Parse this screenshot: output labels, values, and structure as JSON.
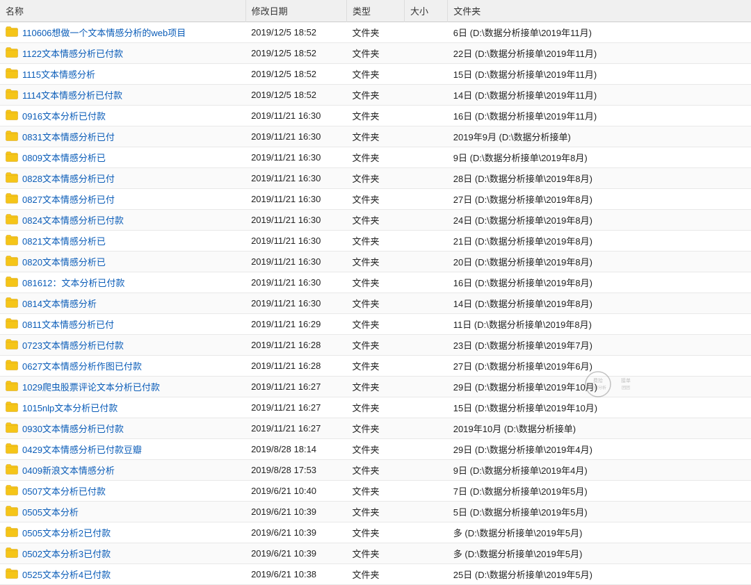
{
  "table": {
    "headers": [
      "名称",
      "修改日期",
      "类型",
      "大小",
      "文件夹"
    ],
    "rows": [
      {
        "name": "110606想做一个文本情感分析的web项目",
        "date": "2019/12/5 18:52",
        "type": "文件夹",
        "size": "",
        "folder": "6日 (D:\\数据分析接单\\2019年11月)"
      },
      {
        "name": "1122文本情感分析已付款",
        "date": "2019/12/5 18:52",
        "type": "文件夹",
        "size": "",
        "folder": "22日 (D:\\数据分析接单\\2019年11月)"
      },
      {
        "name": "1115文本情感分析",
        "date": "2019/12/5 18:52",
        "type": "文件夹",
        "size": "",
        "folder": "15日 (D:\\数据分析接单\\2019年11月)"
      },
      {
        "name": "1114文本情感分析已付款",
        "date": "2019/12/5 18:52",
        "type": "文件夹",
        "size": "",
        "folder": "14日 (D:\\数据分析接单\\2019年11月)"
      },
      {
        "name": "0916文本分析已付款",
        "date": "2019/11/21 16:30",
        "type": "文件夹",
        "size": "",
        "folder": "16日 (D:\\数据分析接单\\2019年11月)"
      },
      {
        "name": "0831文本情感分析已付",
        "date": "2019/11/21 16:30",
        "type": "文件夹",
        "size": "",
        "folder": "2019年9月 (D:\\数据分析接单)"
      },
      {
        "name": "0809文本情感分析已",
        "date": "2019/11/21 16:30",
        "type": "文件夹",
        "size": "",
        "folder": "9日 (D:\\数据分析接单\\2019年8月)"
      },
      {
        "name": "0828文本情感分析已付",
        "date": "2019/11/21 16:30",
        "type": "文件夹",
        "size": "",
        "folder": "28日 (D:\\数据分析接单\\2019年8月)"
      },
      {
        "name": "0827文本情感分析已付",
        "date": "2019/11/21 16:30",
        "type": "文件夹",
        "size": "",
        "folder": "27日 (D:\\数据分析接单\\2019年8月)"
      },
      {
        "name": "0824文本情感分析已付款",
        "date": "2019/11/21 16:30",
        "type": "文件夹",
        "size": "",
        "folder": "24日 (D:\\数据分析接单\\2019年8月)"
      },
      {
        "name": "0821文本情感分析已",
        "date": "2019/11/21 16:30",
        "type": "文件夹",
        "size": "",
        "folder": "21日 (D:\\数据分析接单\\2019年8月)"
      },
      {
        "name": "0820文本情感分析已",
        "date": "2019/11/21 16:30",
        "type": "文件夹",
        "size": "",
        "folder": "20日 (D:\\数据分析接单\\2019年8月)"
      },
      {
        "name": "081612：文本分析已付款",
        "date": "2019/11/21 16:30",
        "type": "文件夹",
        "size": "",
        "folder": "16日 (D:\\数据分析接单\\2019年8月)"
      },
      {
        "name": "0814文本情感分析",
        "date": "2019/11/21 16:30",
        "type": "文件夹",
        "size": "",
        "folder": "14日 (D:\\数据分析接单\\2019年8月)"
      },
      {
        "name": "0811文本情感分析已付",
        "date": "2019/11/21 16:29",
        "type": "文件夹",
        "size": "",
        "folder": "11日 (D:\\数据分析接单\\2019年8月)"
      },
      {
        "name": "0723文本情感分析已付款",
        "date": "2019/11/21 16:28",
        "type": "文件夹",
        "size": "",
        "folder": "23日 (D:\\数据分析接单\\2019年7月)"
      },
      {
        "name": "0627文本情感分析作图已付款",
        "date": "2019/11/21 16:28",
        "type": "文件夹",
        "size": "",
        "folder": "27日 (D:\\数据分析接单\\2019年6月)"
      },
      {
        "name": "1029爬虫股票评论文本分析已付款",
        "date": "2019/11/21 16:27",
        "type": "文件夹",
        "size": "",
        "folder": "29日 (D:\\数据分析接单\\2019年10月)"
      },
      {
        "name": "1015nlp文本分析已付款",
        "date": "2019/11/21 16:27",
        "type": "文件夹",
        "size": "",
        "folder": "15日 (D:\\数据分析接单\\2019年10月)"
      },
      {
        "name": "0930文本情感分析已付款",
        "date": "2019/11/21 16:27",
        "type": "文件夹",
        "size": "",
        "folder": "2019年10月 (D:\\数据分析接单)"
      },
      {
        "name": "0429文本情感分析已付款豆瓣",
        "date": "2019/8/28 18:14",
        "type": "文件夹",
        "size": "",
        "folder": "29日 (D:\\数据分析接单\\2019年4月)"
      },
      {
        "name": "0409新浪文本情感分析",
        "date": "2019/8/28 17:53",
        "type": "文件夹",
        "size": "",
        "folder": "9日 (D:\\数据分析接单\\2019年4月)"
      },
      {
        "name": "0507文本分析已付款",
        "date": "2019/6/21 10:40",
        "type": "文件夹",
        "size": "",
        "folder": "7日 (D:\\数据分析接单\\2019年5月)"
      },
      {
        "name": "0505文本分析",
        "date": "2019/6/21 10:39",
        "type": "文件夹",
        "size": "",
        "folder": "5日 (D:\\数据分析接单\\2019年5月)"
      },
      {
        "name": "0505文本分析2已付款",
        "date": "2019/6/21 10:39",
        "type": "文件夹",
        "size": "",
        "folder": "多 (D:\\数据分析接单\\2019年5月)"
      },
      {
        "name": "0502文本分析3已付款",
        "date": "2019/6/21 10:39",
        "type": "文件夹",
        "size": "",
        "folder": "多 (D:\\数据分析接单\\2019年5月)"
      },
      {
        "name": "0525文本分析4已付款",
        "date": "2019/6/21 10:38",
        "type": "文件夹",
        "size": "",
        "folder": "25日 (D:\\数据分析接单\\2019年5月)"
      }
    ]
  }
}
